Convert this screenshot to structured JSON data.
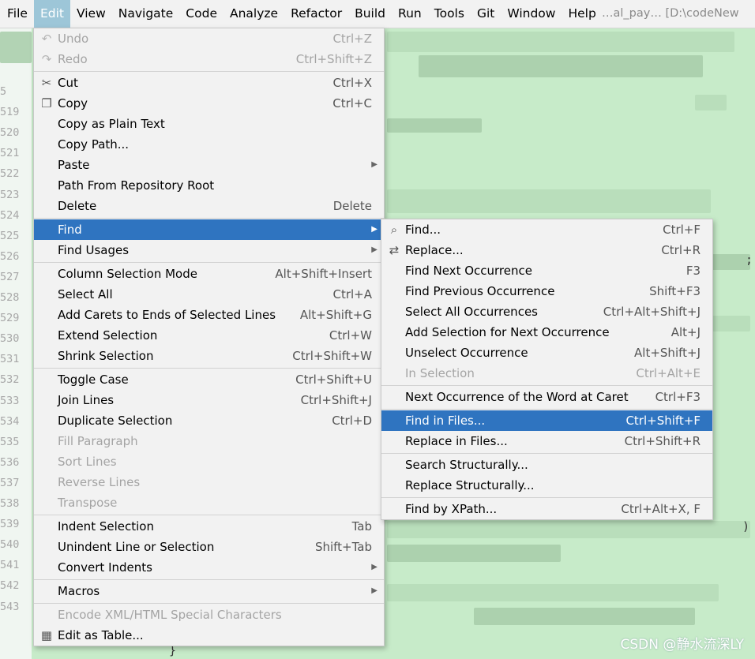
{
  "menubar": {
    "items": [
      "File",
      "Edit",
      "View",
      "Navigate",
      "Code",
      "Analyze",
      "Refactor",
      "Build",
      "Run",
      "Tools",
      "Git",
      "Window",
      "Help"
    ],
    "active": "Edit",
    "project": "…al_pay…    [D:\\codeNew"
  },
  "gutter": {
    "line_numbers": [
      "5",
      "519",
      "520",
      "521",
      "522",
      "523",
      "524",
      "525",
      "526",
      "527",
      "528",
      "529",
      "530",
      "531",
      "532",
      "533",
      "534",
      "535",
      "536",
      "537",
      "538",
      "539",
      "540",
      "541",
      "542",
      "543"
    ]
  },
  "edit_menu": {
    "groups": [
      [
        {
          "label": "Undo",
          "shortcut": "Ctrl+Z",
          "disabled": true,
          "icon": "undo-icon",
          "glyph": "↶"
        },
        {
          "label": "Redo",
          "shortcut": "Ctrl+Shift+Z",
          "disabled": true,
          "icon": "redo-icon",
          "glyph": "↷"
        }
      ],
      [
        {
          "label": "Cut",
          "shortcut": "Ctrl+X",
          "icon": "scissors-icon",
          "glyph": "✂"
        },
        {
          "label": "Copy",
          "shortcut": "Ctrl+C",
          "icon": "copy-icon",
          "glyph": "❐"
        },
        {
          "label": "Copy as Plain Text",
          "shortcut": ""
        },
        {
          "label": "Copy Path...",
          "shortcut": ""
        },
        {
          "label": "Paste",
          "shortcut": "",
          "submenu": true
        },
        {
          "label": "Path From Repository Root",
          "shortcut": ""
        },
        {
          "label": "Delete",
          "shortcut": "Delete"
        }
      ],
      [
        {
          "label": "Find",
          "shortcut": "",
          "submenu": true,
          "selected": true
        },
        {
          "label": "Find Usages",
          "shortcut": "",
          "submenu": true
        }
      ],
      [
        {
          "label": "Column Selection Mode",
          "shortcut": "Alt+Shift+Insert"
        },
        {
          "label": "Select All",
          "shortcut": "Ctrl+A"
        },
        {
          "label": "Add Carets to Ends of Selected Lines",
          "shortcut": "Alt+Shift+G"
        },
        {
          "label": "Extend Selection",
          "shortcut": "Ctrl+W"
        },
        {
          "label": "Shrink Selection",
          "shortcut": "Ctrl+Shift+W"
        }
      ],
      [
        {
          "label": "Toggle Case",
          "shortcut": "Ctrl+Shift+U"
        },
        {
          "label": "Join Lines",
          "shortcut": "Ctrl+Shift+J"
        },
        {
          "label": "Duplicate Selection",
          "shortcut": "Ctrl+D"
        },
        {
          "label": "Fill Paragraph",
          "shortcut": "",
          "disabled": true
        },
        {
          "label": "Sort Lines",
          "shortcut": "",
          "disabled": true
        },
        {
          "label": "Reverse Lines",
          "shortcut": "",
          "disabled": true
        },
        {
          "label": "Transpose",
          "shortcut": "",
          "disabled": true
        }
      ],
      [
        {
          "label": "Indent Selection",
          "shortcut": "Tab"
        },
        {
          "label": "Unindent Line or Selection",
          "shortcut": "Shift+Tab"
        },
        {
          "label": "Convert Indents",
          "shortcut": "",
          "submenu": true
        }
      ],
      [
        {
          "label": "Macros",
          "shortcut": "",
          "submenu": true
        }
      ],
      [
        {
          "label": "Encode XML/HTML Special Characters",
          "shortcut": "",
          "disabled": true
        },
        {
          "label": "Edit as Table...",
          "shortcut": "",
          "icon": "table-icon",
          "glyph": "▦"
        }
      ]
    ]
  },
  "find_menu": {
    "groups": [
      [
        {
          "label": "Find...",
          "shortcut": "Ctrl+F",
          "icon": "search-icon",
          "glyph": "⌕"
        },
        {
          "label": "Replace...",
          "shortcut": "Ctrl+R",
          "icon": "replace-icon",
          "glyph": "⇄"
        },
        {
          "label": "Find Next Occurrence",
          "shortcut": "F3"
        },
        {
          "label": "Find Previous Occurrence",
          "shortcut": "Shift+F3"
        },
        {
          "label": "Select All Occurrences",
          "shortcut": "Ctrl+Alt+Shift+J"
        },
        {
          "label": "Add Selection for Next Occurrence",
          "shortcut": "Alt+J"
        },
        {
          "label": "Unselect Occurrence",
          "shortcut": "Alt+Shift+J"
        },
        {
          "label": "In Selection",
          "shortcut": "Ctrl+Alt+E",
          "disabled": true
        }
      ],
      [
        {
          "label": "Next Occurrence of the Word at Caret",
          "shortcut": "Ctrl+F3"
        }
      ],
      [
        {
          "label": "Find in Files...",
          "shortcut": "Ctrl+Shift+F",
          "selected": true
        },
        {
          "label": "Replace in Files...",
          "shortcut": "Ctrl+Shift+R"
        }
      ],
      [
        {
          "label": "Search Structurally...",
          "shortcut": ""
        },
        {
          "label": "Replace Structurally...",
          "shortcut": ""
        }
      ],
      [
        {
          "label": "Find by XPath...",
          "shortcut": "Ctrl+Alt+X, F"
        }
      ]
    ]
  },
  "watermark": "CSDN @静水流深LY",
  "colors": {
    "selection": "#2f74c0",
    "menu_bg": "#f2f2f2",
    "editor_bg": "#c7ebc9",
    "active_menu": "#9dc6d8"
  }
}
